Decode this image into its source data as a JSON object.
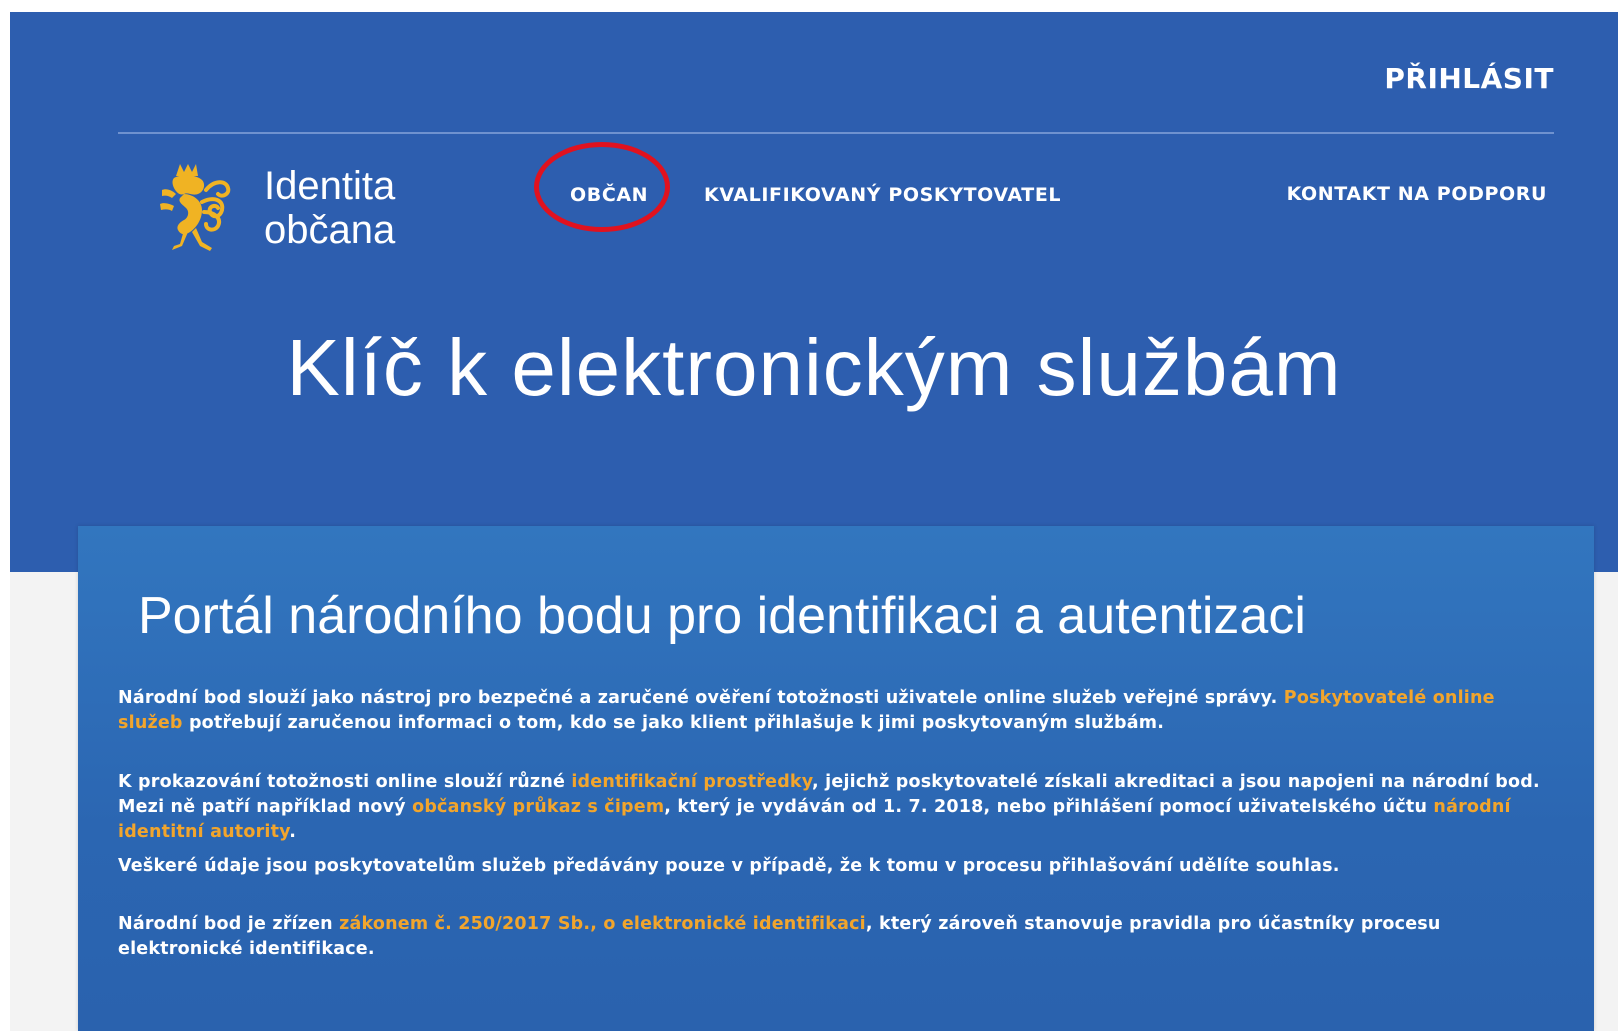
{
  "header": {
    "login_label": "PŘIHLÁSIT",
    "logo_line1": "Identita",
    "logo_line2": "občana",
    "nav": {
      "obcan": "OBČAN",
      "kvalifikovany": "KVALIFIKOVANÝ POSKYTOVATEL",
      "kontakt": "KONTAKT NA PODPORU"
    }
  },
  "hero": {
    "title": "Klíč k elektronickým službám"
  },
  "card": {
    "title": "Portál národního bodu pro identifikaci a autentizaci",
    "p1": {
      "t1": "Národní bod slouží jako nástroj pro bezpečné a zaručené ověření totožnosti uživatele online služeb veřejné správy. ",
      "link1": "Poskytovatelé online služeb",
      "t2": " potřebují zaručenou informaci o tom, kdo se jako klient přihlašuje k jimi poskytovaným službám."
    },
    "p2": {
      "t1": "K prokazování totožnosti online slouží různé ",
      "link1": "identifikační prostředky",
      "t2": ", jejichž poskytovatelé získali akreditaci a jsou napojeni na národní bod. Mezi ně patří například nový ",
      "link2": "občanský průkaz s čipem",
      "t3": ", který je vydáván od 1. 7. 2018, nebo přihlášení pomocí uživatelského účtu ",
      "link3": "národní identitní autority",
      "t4": "."
    },
    "p3": {
      "t1": "Veškeré údaje jsou poskytovatelům služeb předávány pouze v případě, že k tomu v procesu přihlašování udělíte souhlas."
    },
    "p4": {
      "t1": "Národní bod je zřízen ",
      "link1": "zákonem č. 250/2017 Sb., o elektronické identifikaci",
      "t2": ", který zároveň stanovuje pravidla pro účastníky procesu elektronické identifikace."
    }
  },
  "colors": {
    "hero_bg": "#2d5eaf",
    "card_bg": "#2b68b4",
    "link": "#f2a52c",
    "annotation_circle": "#e0121f",
    "logo_gold": "#f0b323"
  },
  "icons": {
    "logo": "czech-lion-icon"
  }
}
